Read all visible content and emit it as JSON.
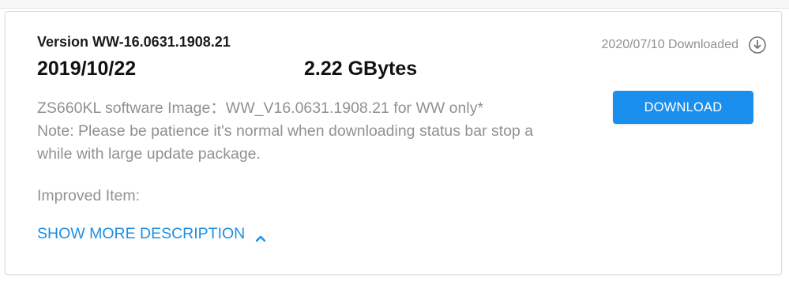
{
  "firmware": {
    "version": "Version WW-16.0631.1908.21",
    "release_date": "2019/10/22",
    "file_size": "2.22 GBytes",
    "description_lines": [
      "ZS660KL software Image：WW_V16.0631.1908.21 for WW only*",
      "Note: Please be patience it's normal when downloading status bar stop a",
      "while with large update package."
    ],
    "improved_label": "Improved Item:",
    "show_more_label": "SHOW MORE DESCRIPTION",
    "downloaded_status": "2020/07/10 Downloaded",
    "download_button_label": "DOWNLOAD"
  },
  "icons": {
    "downloaded": "download-circle-icon",
    "show_more": "chevron-up-icon"
  },
  "colors": {
    "accent": "#1a8fee",
    "link": "#1f8fe0",
    "muted_text": "#8e9195"
  }
}
